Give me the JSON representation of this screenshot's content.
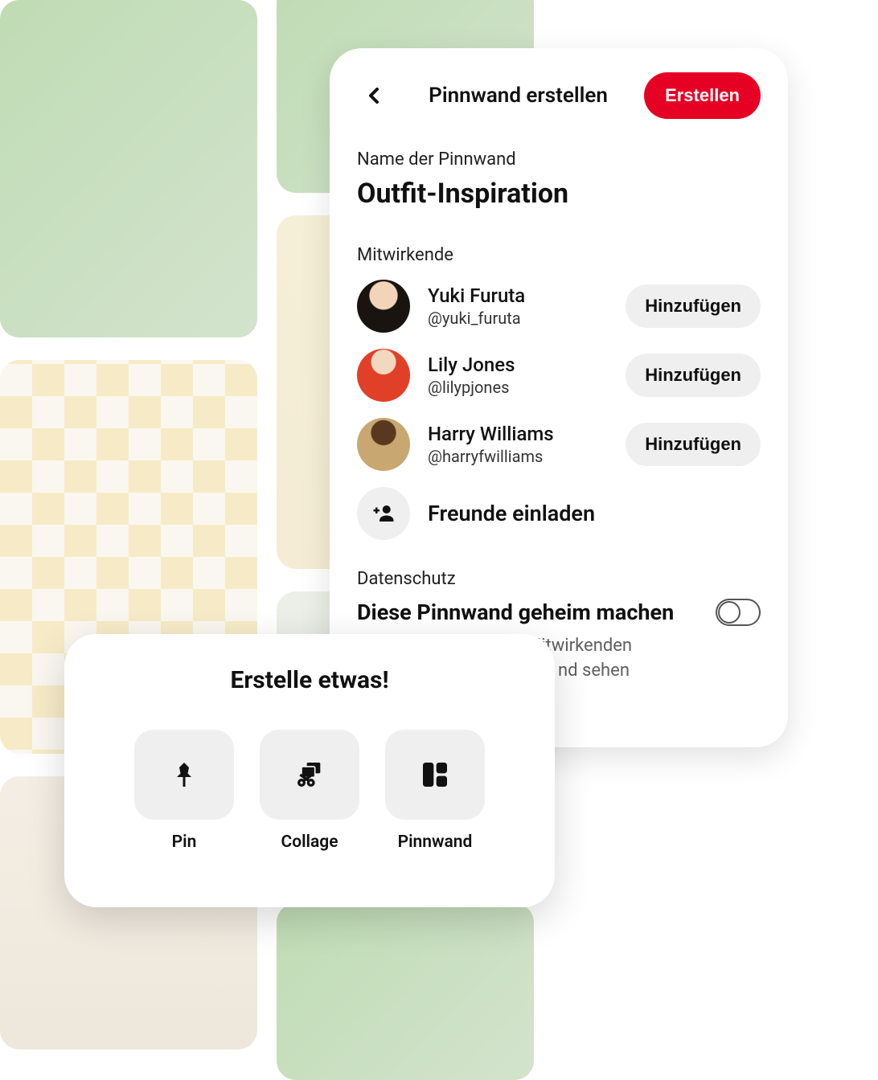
{
  "modal": {
    "title": "Pinnwand erstellen",
    "create_button": "Erstellen",
    "name_label": "Name der Pinnwand",
    "name_value": "Outfit-Inspiration",
    "collaborators_label": "Mitwirkende",
    "collaborators": [
      {
        "name": "Yuki Furuta",
        "handle": "@yuki_furuta",
        "add": "Hinzufügen"
      },
      {
        "name": "Lily Jones",
        "handle": "@lilypjones",
        "add": "Hinzufügen"
      },
      {
        "name": "Harry Williams",
        "handle": "@harryfwilliams",
        "add": "Hinzufügen"
      }
    ],
    "invite_label": "Freunde einladen",
    "privacy_section_label": "Datenschutz",
    "privacy_title": "Diese Pinnwand geheim machen",
    "privacy_subtitle_1": "Mitwirkenden",
    "privacy_subtitle_2": "nd sehen"
  },
  "create_popup": {
    "title": "Erstelle etwas!",
    "options": [
      {
        "label": "Pin",
        "icon": "pin"
      },
      {
        "label": "Collage",
        "icon": "collage"
      },
      {
        "label": "Pinnwand",
        "icon": "board"
      }
    ]
  },
  "colors": {
    "accent": "#e60023",
    "grey_button": "#efefef"
  }
}
